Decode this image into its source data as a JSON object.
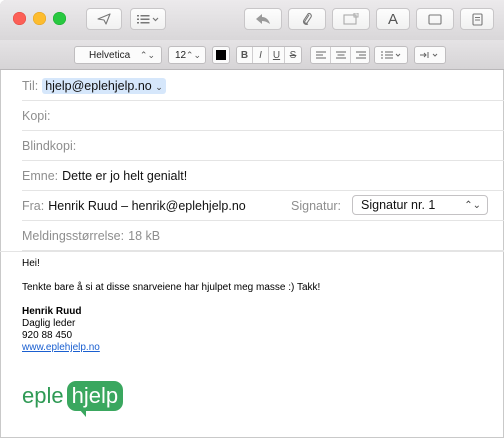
{
  "toolbar": {
    "format_button_label": "A"
  },
  "formatbar": {
    "font_family": "Helvetica",
    "font_size": "12",
    "text_color": "#000000",
    "bold_label": "B",
    "italic_label": "I",
    "underline_label": "U",
    "strike_label": "S"
  },
  "header": {
    "to_label": "Til:",
    "to_value": "hjelp@eplehjelp.no",
    "cc_label": "Kopi:",
    "bcc_label": "Blindkopi:",
    "subject_label": "Emne:",
    "subject_value": "Dette er jo helt genialt!",
    "from_label": "Fra:",
    "from_value": "Henrik Ruud – henrik@eplehjelp.no",
    "signature_label": "Signatur:",
    "signature_value": "Signatur nr. 1",
    "size_label": "Meldingsstørrelse:",
    "size_value": "18 kB"
  },
  "body": {
    "greeting": "Hei!",
    "line1": "Tenkte bare å si at disse snarveiene har hjulpet meg masse :) Takk!",
    "sig_name": "Henrik Ruud",
    "sig_title": "Daglig leder",
    "sig_phone": "920 88 450",
    "sig_link": "www.eplehjelp.no",
    "logo_part1": "eple",
    "logo_part2": "hjelp"
  },
  "colors": {
    "accent": "#3aa75f",
    "link": "#1a5fd0",
    "token_bg": "#d6e7fb"
  }
}
